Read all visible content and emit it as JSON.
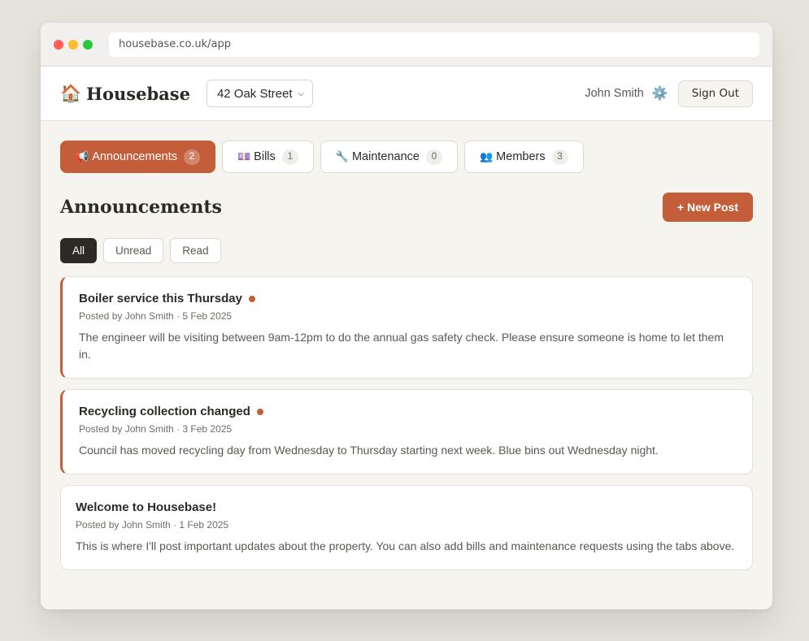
{
  "browser": {
    "url": "housebase.co.uk/app"
  },
  "header": {
    "brand_icon": "🏠",
    "brand": "Housebase",
    "property_selected": "42 Oak Street",
    "user_name": "John Smith",
    "settings_icon": "⚙️",
    "sign_out": "Sign Out"
  },
  "tabs": [
    {
      "icon": "📢",
      "label": "Announcements",
      "count": "2"
    },
    {
      "icon": "💷",
      "label": "Bills",
      "count": "1"
    },
    {
      "icon": "🔧",
      "label": "Maintenance",
      "count": "0"
    },
    {
      "icon": "👥",
      "label": "Members",
      "count": "3"
    }
  ],
  "main": {
    "title": "Announcements",
    "new_post": "+ New Post",
    "filters": [
      "All",
      "Unread",
      "Read"
    ]
  },
  "posts": [
    {
      "title": "Boiler service this Thursday",
      "meta": "Posted by John Smith · 5 Feb 2025",
      "body": "The engineer will be visiting between 9am-12pm to do the annual gas safety check. Please ensure someone is home to let them in."
    },
    {
      "title": "Recycling collection changed",
      "meta": "Posted by John Smith · 3 Feb 2025",
      "body": "Council has moved recycling day from Wednesday to Thursday starting next week. Blue bins out Wednesday night."
    },
    {
      "title": "Welcome to Housebase!",
      "meta": "Posted by John Smith · 1 Feb 2025",
      "body": "This is where I'll post important updates about the property. You can also add bills and maintenance requests using the tabs above."
    }
  ],
  "colors": {
    "accent": "#c45d3a",
    "dark": "#2b2a26",
    "background": "#f6f4ef"
  }
}
